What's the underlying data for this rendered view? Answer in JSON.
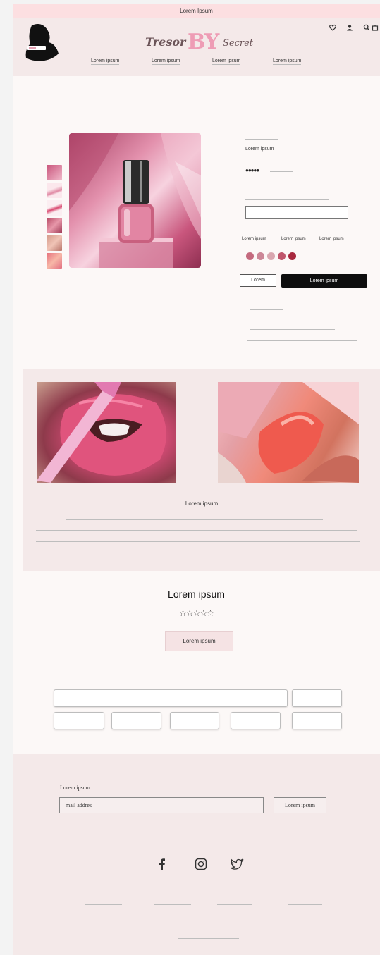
{
  "announcement": "Lorem Ipsum",
  "brand": {
    "part1": "Tresor",
    "part2": "BY",
    "part3": "Secret",
    "logo_text": "Tresor"
  },
  "nav": [
    "Lorem ipsum",
    "Lorem ipsum",
    "Lorem ipsum",
    "Lorem ipsum"
  ],
  "header_icons": [
    "heart-icon",
    "user-icon",
    "search-icon",
    "bag-icon"
  ],
  "product": {
    "title": "Lorem ipsum",
    "rating_stars": "●●●●●",
    "options": [
      "Lorem ipsum",
      "Lorem ipsum",
      "Lorem ipsum"
    ],
    "swatch_colors": [
      "#c46a7e",
      "#cc8797",
      "#d9a7b0",
      "#c0566c",
      "#a8283e"
    ],
    "secondary_button": "Lorem",
    "buy_button": "Lorem ipsum"
  },
  "feature": {
    "title": "Lorem ipsum"
  },
  "reviews": {
    "title": "Lorem ipsum",
    "stars": "☆☆☆☆☆",
    "button": "Lorem ipsum"
  },
  "newsletter": {
    "label": "Lorem ipsum",
    "placeholder": "mail addres",
    "button": "Lorem ipsum"
  },
  "social": [
    "facebook-icon",
    "instagram-icon",
    "twitter-icon"
  ],
  "colors": {
    "announce_bg": "#fcdfe1",
    "header_bg": "#f4e9e9",
    "accent": "#ee9cb5",
    "buy_button": "#0e0e0e"
  }
}
